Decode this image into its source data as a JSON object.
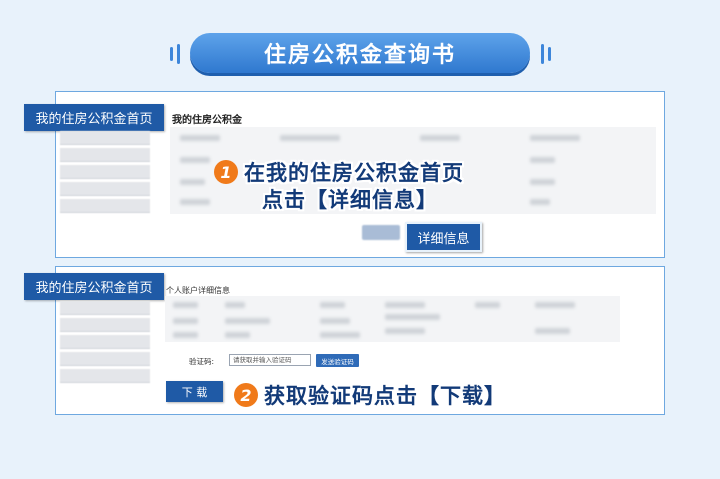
{
  "page": {
    "title": "住房公积金查询书"
  },
  "panel1": {
    "tag": "我的住房公积金首页",
    "heading": "我的住房公积金",
    "step_number": "1",
    "step_line1": "在我的住房公积金首页",
    "step_line2": "点击【详细信息】",
    "detail_button": "详细信息"
  },
  "panel2": {
    "tag": "我的住房公积金首页",
    "heading": "个人账户详细信息",
    "captcha_label": "验证码:",
    "captcha_placeholder": "请获取并输入验证码",
    "send_code_button": "发送验证码",
    "download_button": "下 载",
    "step_number": "2",
    "step_text": "获取验证码点击【下载】"
  },
  "colors": {
    "accent": "#1f5aa6",
    "step_badge": "#f07a1a",
    "background": "#e8f2fb"
  }
}
